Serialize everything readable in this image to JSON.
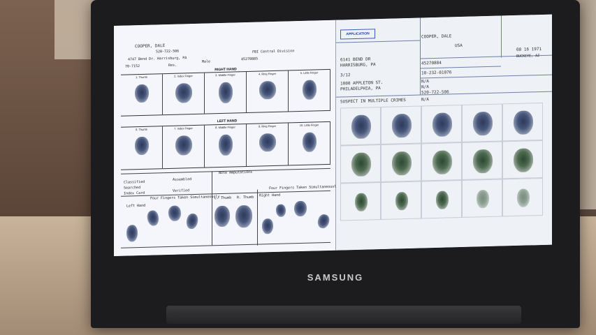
{
  "device": {
    "brand": "SAMSUNG"
  },
  "left_card": {
    "name": "COOPER, DALE",
    "phone": "520-722-506",
    "address": "4747 Bend Dr. Harrisburg, PA",
    "code": "70-7152",
    "field_res": "Res.",
    "field_male": "Male",
    "agency": "FBI Central Division",
    "agency_id": "45270885",
    "right_hand_title": "RIGHT HAND",
    "left_hand_title": "LEFT HAND",
    "right_fingers": [
      "1. Thumb",
      "2. Index Finger",
      "3. Middle Finger",
      "4. Ring Finger",
      "5. Little Finger"
    ],
    "left_fingers": [
      "6. Thumb",
      "7. Index Finger",
      "8. Middle Finger",
      "9. Ring Finger",
      "10. Little Finger"
    ],
    "classified": "Classified",
    "searched": "Searched",
    "index_card": "Index Card",
    "assembled": "Assembled",
    "verified": "Verified",
    "note_amputations": "Note Amputations",
    "four_fingers_left": "Four Fingers Taken Simultaneously",
    "left_hand_label": "Left Hand",
    "four_fingers_right": "Four Fingers Taken Simultaneously",
    "right_hand_label": "Right Hand",
    "thumb_left": "L. Thumb",
    "thumb_right": "R. Thumb"
  },
  "right_card": {
    "application_label": "APPLICATION",
    "name": "COOPER, DALE",
    "address_line1": "6141 BEND DR",
    "address_line2": "HARRISBURG, PA",
    "race": "USA",
    "date": "3/12",
    "work_address1": "1000 APPLETON ST.",
    "work_address2": "PHILADELPHIA, PA",
    "id_number": "45270884",
    "ssn": "10-232-01076",
    "na1": "N/A",
    "na2": "N/A",
    "phone": "520-722-506",
    "na3": "N/A",
    "dob": "08 16 1971",
    "pob": "BUCKEYE, AZ",
    "note": "SUSPECT IN MULTIPLE CRIMES"
  }
}
